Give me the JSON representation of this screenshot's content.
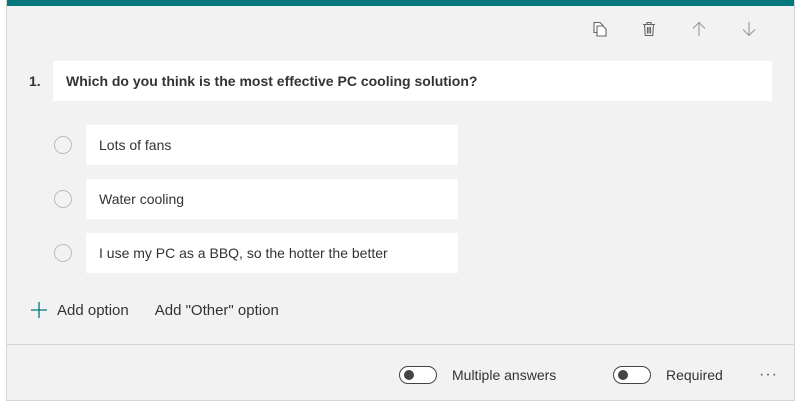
{
  "accent_color": "#03787c",
  "toolbar": {
    "icons": [
      "copy-icon",
      "trash-icon",
      "arrow-up-icon",
      "arrow-down-icon"
    ]
  },
  "question": {
    "number": "1.",
    "title": "Which do you think is the most effective PC cooling solution?",
    "options": [
      {
        "label": "Lots of fans",
        "selected": false
      },
      {
        "label": "Water cooling",
        "selected": false
      },
      {
        "label": "I use my PC as a BBQ, so the hotter the better",
        "selected": false
      }
    ]
  },
  "add": {
    "add_option_label": "Add option",
    "add_other_label": "Add \"Other\" option"
  },
  "footer": {
    "multiple_answers_label": "Multiple answers",
    "multiple_answers_on": false,
    "required_label": "Required",
    "required_on": false,
    "more_label": "···"
  }
}
